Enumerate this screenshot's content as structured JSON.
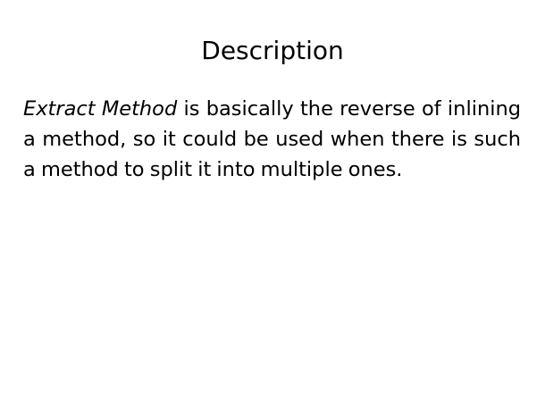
{
  "slide": {
    "title": "Description",
    "body": {
      "term": "Extract Method",
      "text": " is basically the reverse of inlining a method, so it could be used when there is such a method to split it into multiple ones."
    }
  }
}
